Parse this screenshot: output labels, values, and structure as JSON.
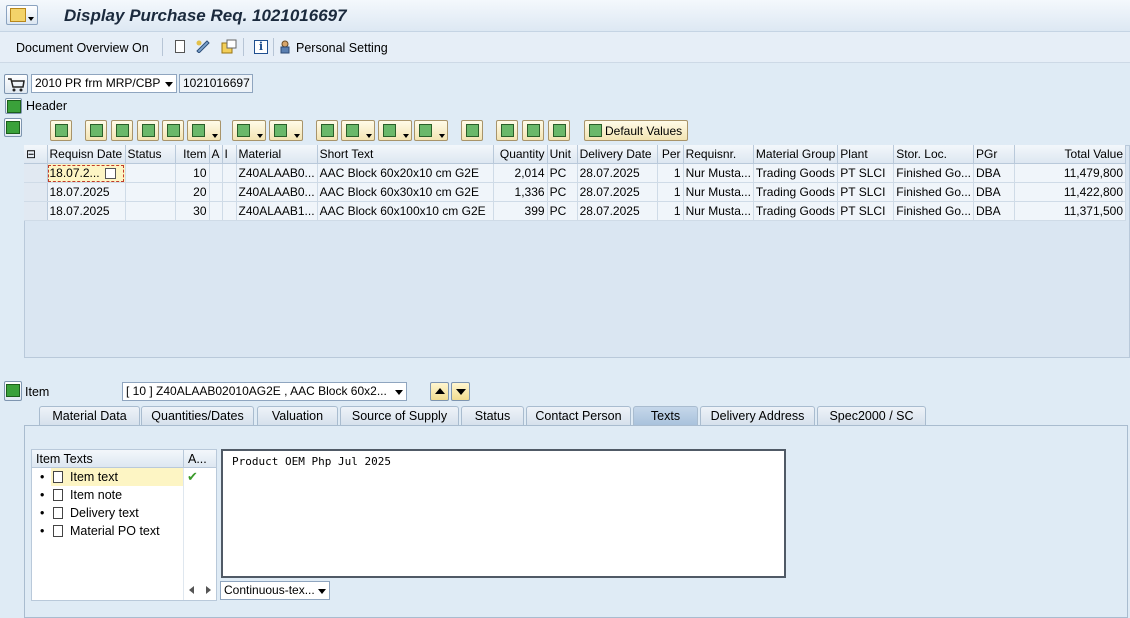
{
  "window": {
    "title": "Display Purchase Req. 1021016697"
  },
  "app_toolbar": {
    "document_overview": "Document Overview On",
    "personal_setting": "Personal Setting"
  },
  "header_area": {
    "doc_type": "2010 PR frm MRP/CBP",
    "doc_number": "1021016697",
    "header_label": "Header"
  },
  "alv_toolbar": {
    "default_values": "Default Values"
  },
  "grid": {
    "columns": [
      "Requisn Date",
      "Status",
      "Item",
      "A",
      "I",
      "Material",
      "Short Text",
      "Quantity",
      "Unit",
      "Delivery Date",
      "Per",
      "Requisnr.",
      "Material Group",
      "Plant",
      "Stor. Loc.",
      "PGr",
      "Total Value"
    ],
    "rows": [
      [
        "18.07.2...",
        "",
        "10",
        "",
        "",
        "Z40ALAAB0...",
        "AAC Block 60x20x10 cm G2E",
        "2,014",
        "PC",
        "28.07.2025",
        "1",
        "Nur Musta...",
        "Trading Goods",
        "PT SLCI",
        "Finished Go...",
        "DBA",
        "11,479,800"
      ],
      [
        "18.07.2025",
        "",
        "20",
        "",
        "",
        "Z40ALAAB0...",
        "AAC Block 60x30x10 cm G2E",
        "1,336",
        "PC",
        "28.07.2025",
        "1",
        "Nur Musta...",
        "Trading Goods",
        "PT SLCI",
        "Finished Go...",
        "DBA",
        "11,422,800"
      ],
      [
        "18.07.2025",
        "",
        "30",
        "",
        "",
        "Z40ALAAB1...",
        "AAC Block 60x100x10 cm G2E",
        "399",
        "PC",
        "28.07.2025",
        "1",
        "Nur Musta...",
        "Trading Goods",
        "PT SLCI",
        "Finished Go...",
        "DBA",
        "11,371,500"
      ]
    ]
  },
  "item_area": {
    "label": "Item",
    "selected": "[ 10 ] Z40ALAAB02010AG2E , AAC Block 60x2..."
  },
  "tabs": [
    {
      "label": "Material Data"
    },
    {
      "label": "Quantities/Dates"
    },
    {
      "label": "Valuation"
    },
    {
      "label": "Source of Supply"
    },
    {
      "label": "Status"
    },
    {
      "label": "Contact Person"
    },
    {
      "label": "Texts",
      "active": true
    },
    {
      "label": "Delivery Address"
    },
    {
      "label": "Spec2000 / SC"
    }
  ],
  "texts_tab": {
    "tree_header": "Item Texts",
    "tree_header_col2": "A...",
    "items": [
      {
        "label": "Item text",
        "selected": true,
        "has_text": true
      },
      {
        "label": "Item note"
      },
      {
        "label": "Delivery text"
      },
      {
        "label": "Material PO text"
      }
    ],
    "editor_text": "Product OEM Php Jul 2025",
    "format_select": "Continuous-tex..."
  },
  "colors": {
    "accent_selected": "#fdf5c4",
    "check": "#3a9a2a"
  }
}
